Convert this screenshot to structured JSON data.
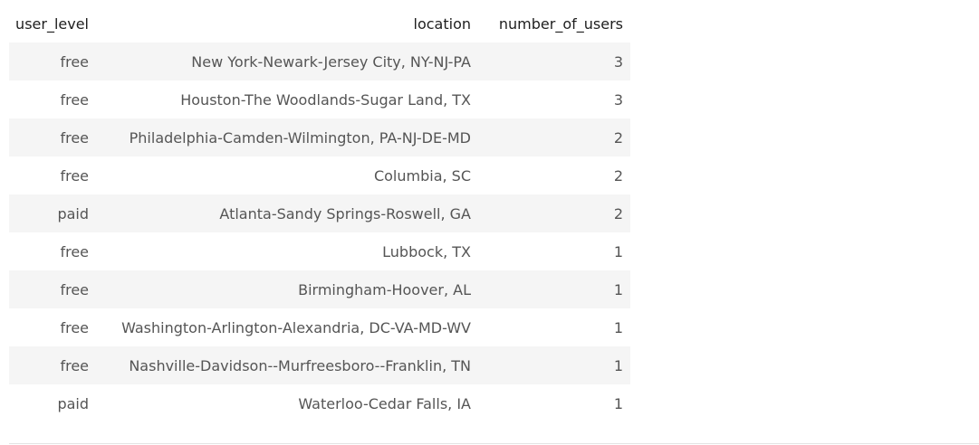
{
  "table": {
    "columns": [
      "user_level",
      "location",
      "number_of_users"
    ],
    "rows": [
      {
        "user_level": "free",
        "location": "New York-Newark-Jersey City, NY-NJ-PA",
        "number_of_users": "3"
      },
      {
        "user_level": "free",
        "location": "Houston-The Woodlands-Sugar Land, TX",
        "number_of_users": "3"
      },
      {
        "user_level": "free",
        "location": "Philadelphia-Camden-Wilmington, PA-NJ-DE-MD",
        "number_of_users": "2"
      },
      {
        "user_level": "free",
        "location": "Columbia, SC",
        "number_of_users": "2"
      },
      {
        "user_level": "paid",
        "location": "Atlanta-Sandy Springs-Roswell, GA",
        "number_of_users": "2"
      },
      {
        "user_level": "free",
        "location": "Lubbock, TX",
        "number_of_users": "1"
      },
      {
        "user_level": "free",
        "location": "Birmingham-Hoover, AL",
        "number_of_users": "1"
      },
      {
        "user_level": "free",
        "location": "Washington-Arlington-Alexandria, DC-VA-MD-WV",
        "number_of_users": "1"
      },
      {
        "user_level": "free",
        "location": "Nashville-Davidson--Murfreesboro--Franklin, TN",
        "number_of_users": "1"
      },
      {
        "user_level": "paid",
        "location": "Waterloo-Cedar Falls, IA",
        "number_of_users": "1"
      }
    ]
  },
  "colors": {
    "stripe": "#f5f5f5",
    "header_text": "#1f1f1f",
    "cell_text": "#555555",
    "divider": "#e3e3e3"
  }
}
